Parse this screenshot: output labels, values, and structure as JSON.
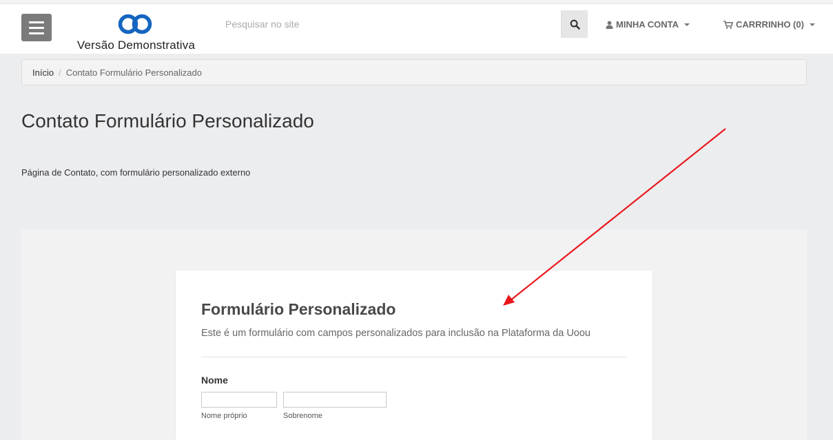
{
  "header": {
    "logo_text": "Versão Demonstrativa",
    "search_placeholder": "Pesquisar no site",
    "account_label": "MINHA CONTA",
    "cart_label": "CARRRINHO (0)",
    "icons": {
      "menu": "hamburger-icon",
      "logo": "chain-link-logo-icon",
      "search": "search-icon",
      "account": "user-icon",
      "cart": "cart-icon",
      "dropdown": "caret-down-icon"
    },
    "logo_color": "#1565c0"
  },
  "breadcrumb": {
    "home": "Início",
    "separator": "/",
    "current": "Contato Formulário Personalizado"
  },
  "page": {
    "title": "Contato Formulário Personalizado",
    "description": "Página de Contato, com formulário personalizado externo"
  },
  "form": {
    "title": "Formulário Personalizado",
    "subtitle": "Este é um formulário com campos personalizados para inclusão na Plataforma da Uoou",
    "name_field": {
      "label": "Nome",
      "first_sublabel": "Nome próprio",
      "last_sublabel": "Sobrenome",
      "first_value": "",
      "last_value": ""
    }
  },
  "annotation": {
    "arrow_color": "#e8161b"
  }
}
